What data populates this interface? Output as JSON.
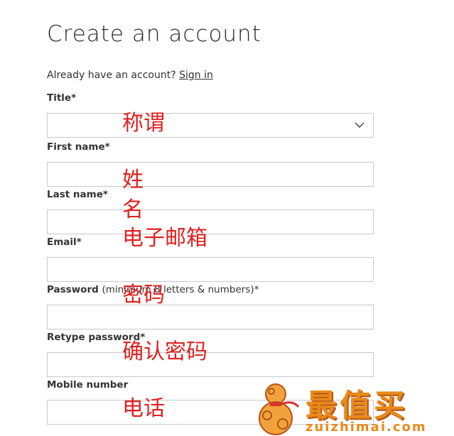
{
  "page": {
    "title": "Create an account",
    "signin_prompt": "Already have an account?",
    "signin_link": "Sign in"
  },
  "form": {
    "title_label": "Title*",
    "first_name_label": "First name*",
    "last_name_label": "Last name*",
    "email_label": "Email*",
    "password_label": "Password",
    "password_hint": "(minimum 8 letters & numbers)*",
    "retype_password_label": "Retype password*",
    "mobile_label": "Mobile number"
  },
  "annotations": {
    "title": "称谓",
    "first_name": "姓",
    "last_name": "名",
    "email": "电子邮箱",
    "password": "密码",
    "retype_password": "确认密码",
    "mobile": "电话"
  },
  "watermark": {
    "name_cn": "最值买",
    "domain": "zuizhimai.com"
  },
  "colors": {
    "annotation": "#e02020",
    "watermark": "#e88a1a",
    "border": "#c8c8c8"
  },
  "icons": [
    "chevron-down-icon",
    "gourd-logo-icon"
  ]
}
